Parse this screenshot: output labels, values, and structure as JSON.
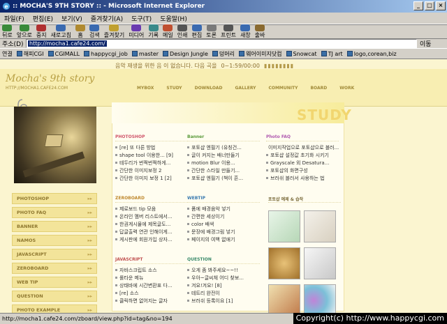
{
  "window": {
    "title": ":: MOCHA'S 9TH STORY :: - Microsoft Internet Explorer",
    "btns": [
      "_",
      "□",
      "×"
    ]
  },
  "menu": [
    "파일(F)",
    "편집(E)",
    "보기(V)",
    "즐겨찾기(A)",
    "도구(T)",
    "도움말(H)"
  ],
  "toolbar": [
    {
      "label": "뒤로",
      "icon": "back-icon"
    },
    {
      "label": "앞으로",
      "icon": "forward-icon"
    },
    {
      "label": "중지",
      "icon": "stop-icon"
    },
    {
      "label": "새로고침",
      "icon": "refresh-icon"
    },
    {
      "label": "홈",
      "icon": "home-icon"
    },
    {
      "label": "검색",
      "icon": "search-icon"
    },
    {
      "label": "즐겨찾기",
      "icon": "favorites-icon"
    },
    {
      "label": "미디어",
      "icon": "media-icon"
    },
    {
      "label": "기록",
      "icon": "history-icon"
    },
    {
      "label": "메일",
      "icon": "mail-icon"
    },
    {
      "label": "인쇄",
      "icon": "print-icon"
    },
    {
      "label": "편집",
      "icon": "edit-icon"
    },
    {
      "label": "토론",
      "icon": "discuss-icon"
    },
    {
      "label": "프린트",
      "icon": "printer-icon"
    },
    {
      "label": "새창",
      "icon": "newwindow-icon"
    },
    {
      "label": "출바",
      "icon": "bar-icon"
    }
  ],
  "address": {
    "label": "주소(D)",
    "value": "http://mocha1.cafe24.com/",
    "go": "이동"
  },
  "links": {
    "label": "연결",
    "items": [
      "해피CGI",
      "CGIMALL",
      "happycgi_job",
      "master",
      "Design Jungle",
      "덩머리",
      "웨어이미지닷컴",
      "Snowcat",
      "TJ art",
      "logo,corean,biz"
    ]
  },
  "page": {
    "music": "음악 재생을 위한 음 이 없습니다. 다음 곡을",
    "music_time": "0~1:59/00:00",
    "logo": "Mocha's 9th story",
    "logo_url": "HTTP://MOCHA1.CAFE24.COM",
    "nav": [
      "MYBOX",
      "STUDY",
      "DOWNLOAD",
      "GALLERY",
      "COMMUNITY",
      "BOARD",
      "WORK"
    ],
    "side_menu": [
      "PHOTOSHOP",
      "PHOTO FAQ",
      "BANNER",
      "NAMOS",
      "JAVASCRIPT",
      "ZEROBOARD",
      "WEB TIP",
      "QUESTION",
      "PHOTO EXAMPLE"
    ],
    "study_title": "STUDY",
    "cols": [
      {
        "title": "PHOTOSHOP",
        "color": "#d0556b",
        "rows": [
          "[re] 또 다른 방법",
          "shape tool 이용한... [9]",
          "테두리가 번쩍번쩍하게...",
          "간단한 이미지보정 2",
          "간단한 이미지 보정 1 [2]"
        ]
      },
      {
        "title": "Banner",
        "color": "#5a9a3a",
        "rows": [
          "포토샵 엔필기 (유칭건...",
          "글이 커지는 배너만들기",
          "motion Blur 이용...",
          "간단한 스타일 만들기...",
          "포토샵 엔필기 (책이 흔..."
        ]
      },
      {
        "title": "Photo FAQ",
        "color": "#b05ab0",
        "rows": [
          "이미지작업으로 포토샵으로 블러...",
          "포토샵 설정값 초기화 시키기",
          "Grayscale 외 Desatura...",
          "포토샵의 화면구성",
          "브러쉬 블러서 사용하는 법"
        ]
      },
      {
        "title": "ZEROBOARD",
        "color": "#c08a30",
        "rows": [
          "제로보드 tip 모음",
          "온라인 멤버 리스트에서...",
          "한권게시물에 제목글도...",
          "답글출력 연관 인해이게...",
          "게시판에 회원가입 상자..."
        ]
      },
      {
        "title": "WEBTIP",
        "color": "#3a7ab0",
        "rows": [
          "폼에 배경음악 넣기",
          "간편한 세상이기",
          "color 배색",
          "문장에 배경그림 넣기",
          "페이지의 여백 없애기"
        ]
      },
      {
        "title": "포토샵 예제 & 습작",
        "color": "#7a6b3a",
        "rows": []
      },
      {
        "title": "JAVASCRIPT",
        "color": "#c05050",
        "rows": [
          "자바스크립트 소스",
          "롤타운 메뉴",
          "상태바에 시간변환표 다...",
          "[re] 소스",
          "클릭하면 없어지는 글자"
        ]
      },
      {
        "title": "QUESTION",
        "color": "#3a8a6a",
        "rows": [
          "오게 좀 봐주세요~~!!",
          "우아~글씨체 어디 찾보...",
          "겨요!겨요! [8]",
          "테트리 완전이",
          "브러쉬 등록이요 [1]"
        ]
      }
    ]
  },
  "status": "http://mocha1.cafe24.com/zboard/view.php?id=tag&no=194",
  "copyright": "Copyright(c) http://www.happycgi.com"
}
